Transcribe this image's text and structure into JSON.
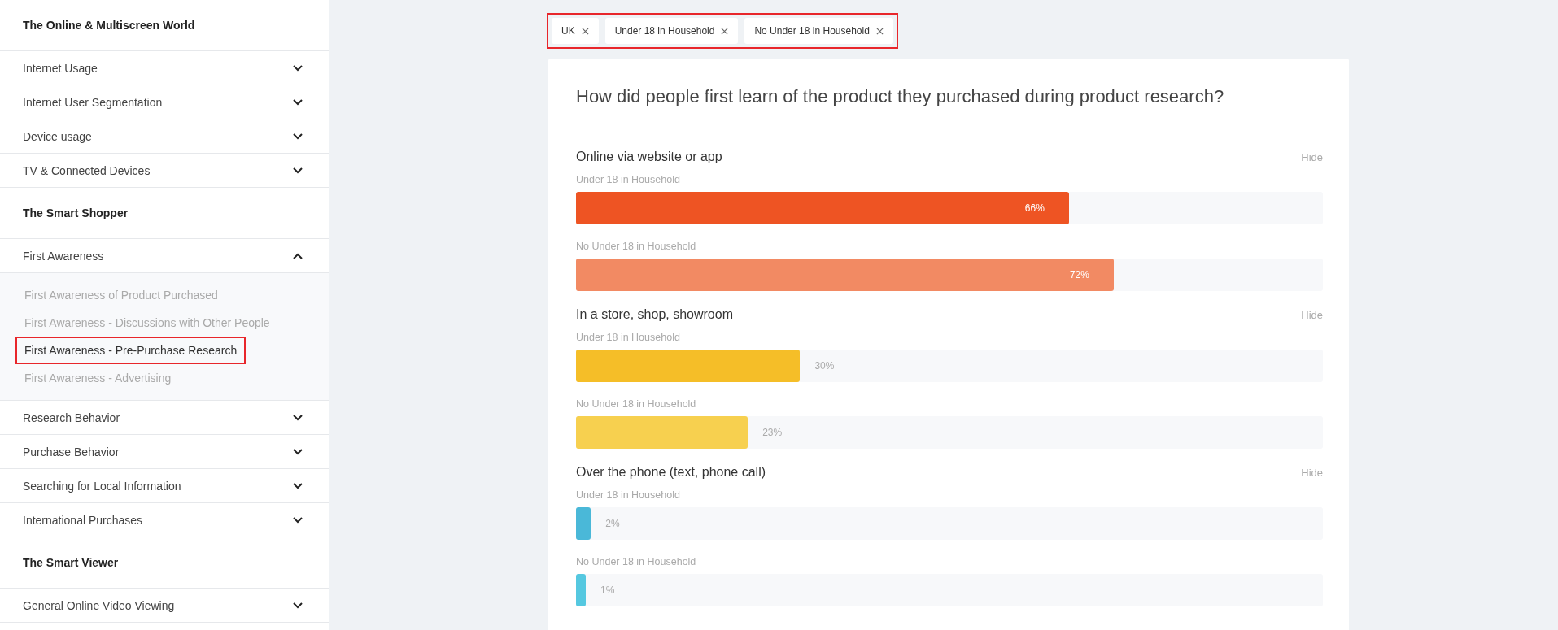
{
  "sidebar": {
    "sections": [
      {
        "title": "The Online & Multiscreen World",
        "items": [
          {
            "label": "Internet Usage",
            "expanded": false
          },
          {
            "label": "Internet User Segmentation",
            "expanded": false
          },
          {
            "label": "Device usage",
            "expanded": false
          },
          {
            "label": "TV & Connected Devices",
            "expanded": false
          }
        ]
      },
      {
        "title": "The Smart Shopper",
        "items": [
          {
            "label": "First Awareness",
            "expanded": true,
            "children": [
              {
                "label": "First Awareness of Product Purchased",
                "selected": false
              },
              {
                "label": "First Awareness - Discussions with Other People",
                "selected": false
              },
              {
                "label": "First Awareness - Pre-Purchase Research",
                "selected": true
              },
              {
                "label": "First Awareness - Advertising",
                "selected": false
              }
            ]
          },
          {
            "label": "Research Behavior",
            "expanded": false
          },
          {
            "label": "Purchase Behavior",
            "expanded": false
          },
          {
            "label": "Searching for Local Information",
            "expanded": false
          },
          {
            "label": "International Purchases",
            "expanded": false
          }
        ]
      },
      {
        "title": "The Smart Viewer",
        "items": [
          {
            "label": "General Online Video Viewing",
            "expanded": false
          }
        ]
      }
    ]
  },
  "filters": [
    {
      "label": "UK"
    },
    {
      "label": "Under 18 in Household"
    },
    {
      "label": "No Under 18 in Household"
    }
  ],
  "card": {
    "title": "How did people first learn of the product they purchased during product research?",
    "groups": [
      {
        "label": "Online via website or app",
        "action": "Hide",
        "bars": [
          {
            "series": "Under 18 in Household",
            "value": "66%",
            "level": 0.66,
            "color": "#ee5423"
          },
          {
            "series": "No Under 18 in Household",
            "value": "72%",
            "level": 0.72,
            "color": "#f28a63"
          }
        ]
      },
      {
        "label": "In a store, shop, showroom",
        "action": "Hide",
        "bars": [
          {
            "series": "Under 18 in Household",
            "value": "30%",
            "level": 0.3,
            "color": "#f5be28"
          },
          {
            "series": "No Under 18 in Household",
            "value": "23%",
            "level": 0.23,
            "color": "#f7d04f"
          }
        ]
      },
      {
        "label": "Over the phone (text, phone call)",
        "action": "Hide",
        "bars": [
          {
            "series": "Under 18 in Household",
            "value": "2%",
            "level": 0.02,
            "color": "#4ab8d8"
          },
          {
            "series": "No Under 18 in Household",
            "value": "1%",
            "level": 0.01,
            "color": "#55c8e0"
          }
        ]
      }
    ]
  }
}
